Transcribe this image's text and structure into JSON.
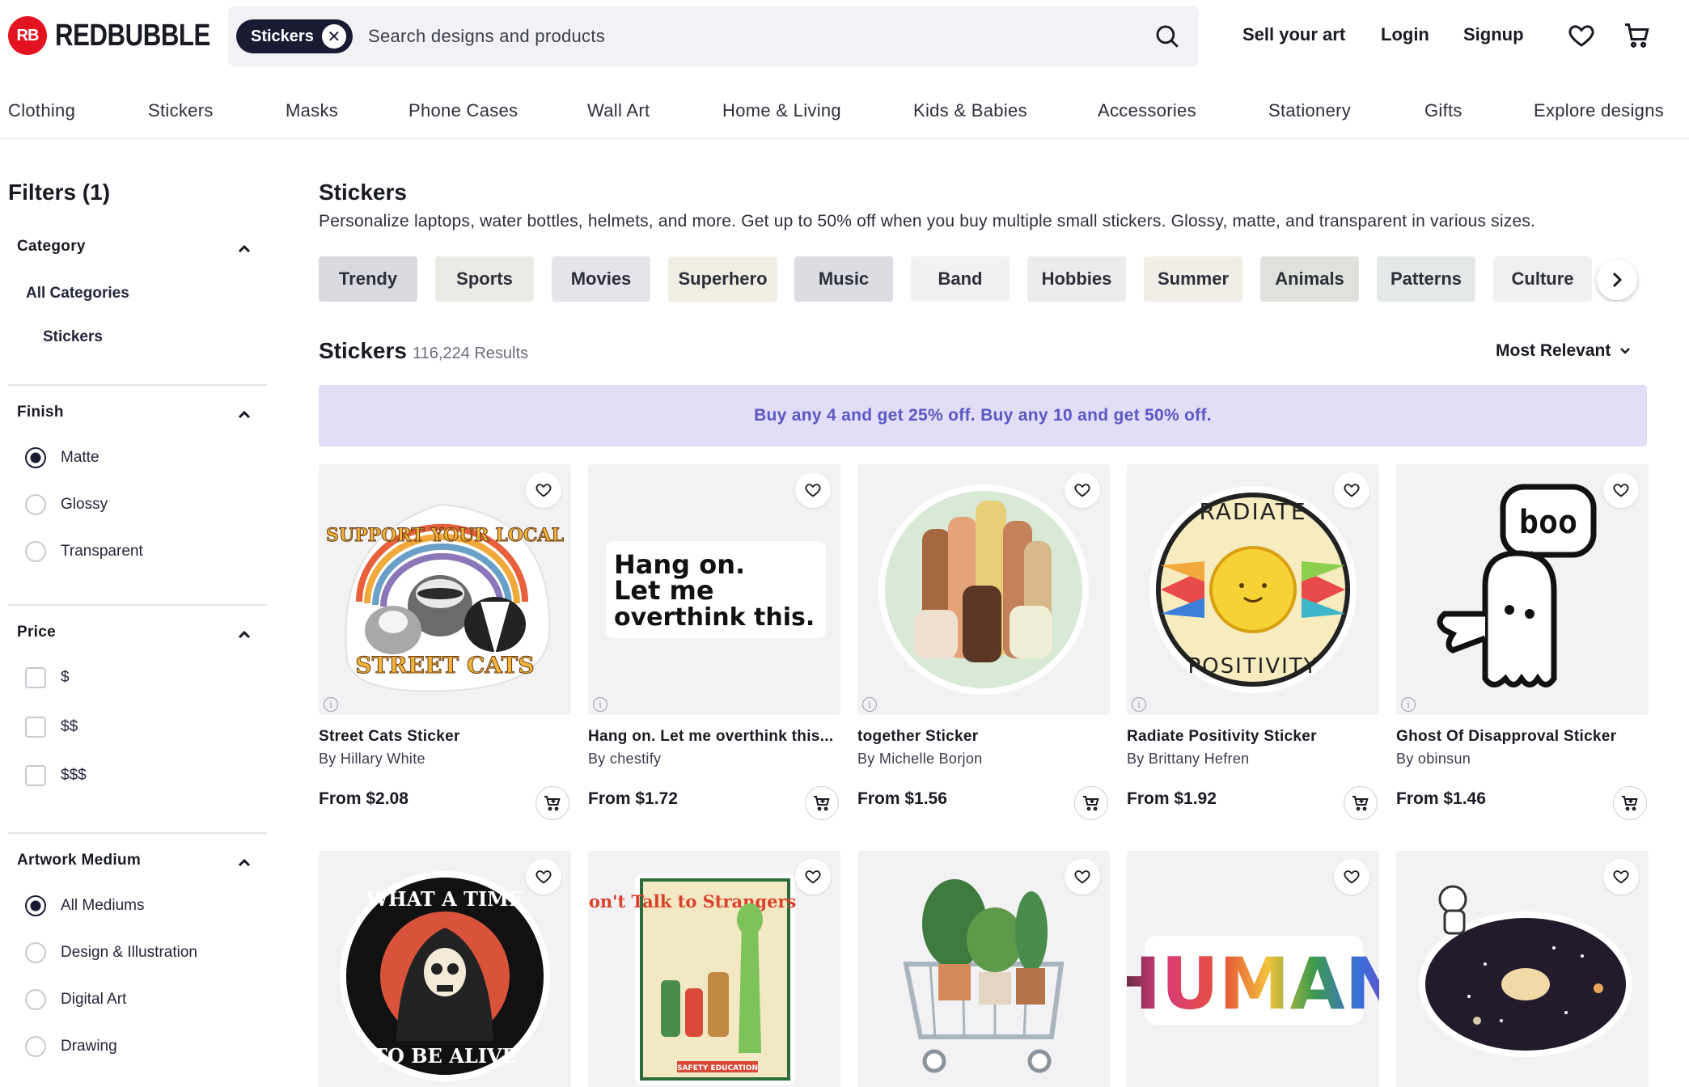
{
  "header": {
    "logo_mark": "RB",
    "logo_text": "REDBUBBLE",
    "search_chip": "Stickers",
    "search_placeholder": "Search designs and products",
    "links": {
      "sell": "Sell your art",
      "login": "Login",
      "signup": "Signup"
    }
  },
  "nav": [
    "Clothing",
    "Stickers",
    "Masks",
    "Phone Cases",
    "Wall Art",
    "Home & Living",
    "Kids & Babies",
    "Accessories",
    "Stationery",
    "Gifts",
    "Explore designs"
  ],
  "sidebar": {
    "title": "Filters (1)",
    "category": {
      "title": "Category",
      "all": "All Categories",
      "current": "Stickers"
    },
    "finish": {
      "title": "Finish",
      "options": [
        "Matte",
        "Glossy",
        "Transparent"
      ],
      "selected": "Matte"
    },
    "price": {
      "title": "Price",
      "options": [
        "$",
        "$$",
        "$$$"
      ]
    },
    "medium": {
      "title": "Artwork Medium",
      "options": [
        "All Mediums",
        "Design & Illustration",
        "Digital Art",
        "Drawing"
      ],
      "selected": "All Mediums"
    }
  },
  "main": {
    "title": "Stickers",
    "description": "Personalize laptops, water bottles, helmets, and more. Get up to 50% off when you buy multiple small stickers. Glossy, matte, and transparent in various sizes.",
    "pills": [
      {
        "label": "Trendy",
        "color": "#d9dadf"
      },
      {
        "label": "Sports",
        "color": "#ebebe6"
      },
      {
        "label": "Movies",
        "color": "#e4e4ea"
      },
      {
        "label": "Superhero",
        "color": "#f1efe4"
      },
      {
        "label": "Music",
        "color": "#dcdde3"
      },
      {
        "label": "Band",
        "color": "#f1f1f3"
      },
      {
        "label": "Hobbies",
        "color": "#ececef"
      },
      {
        "label": "Summer",
        "color": "#f0eee6"
      },
      {
        "label": "Animals",
        "color": "#dee1dc"
      },
      {
        "label": "Patterns",
        "color": "#e4e8e8"
      },
      {
        "label": "Culture",
        "color": "#f0f0f2"
      }
    ],
    "results_title": "Stickers",
    "results_count": "116,224 Results",
    "sort_label": "Most Relevant",
    "promo": "Buy any 4 and get 25% off.  Buy any 10 and get 50% off."
  },
  "products": [
    {
      "title": "Street Cats Sticker",
      "artist": "By Hillary White",
      "price": "From $2.08"
    },
    {
      "title": "Hang on. Let me overthink this...",
      "artist": "By chestify",
      "price": "From $1.72",
      "art_lines": [
        "Hang on.",
        "Let me",
        "overthink this."
      ]
    },
    {
      "title": "together Sticker",
      "artist": "By Michelle Borjon",
      "price": "From $1.56"
    },
    {
      "title": "Radiate Positivity Sticker",
      "artist": "By Brittany Hefren",
      "price": "From $1.92"
    },
    {
      "title": "Ghost Of Disapproval Sticker",
      "artist": "By obinsun",
      "price": "From $1.46",
      "art_text": "boo"
    },
    {
      "title": "",
      "artist": "",
      "price": ""
    },
    {
      "title": "",
      "artist": "",
      "price": ""
    },
    {
      "title": "",
      "artist": "",
      "price": ""
    },
    {
      "title": "",
      "artist": "",
      "price": "",
      "art_text": "HUMAN"
    },
    {
      "title": "",
      "artist": "",
      "price": ""
    }
  ],
  "art_lettering": {
    "street_cats_top": "SUPPORT YOUR LOCAL",
    "street_cats_bottom": "STREET CATS",
    "radiate_top": "RADIATE",
    "radiate_bottom": "POSITIVITY",
    "time_top": "WHAT A TIME",
    "time_bottom": "TO BE ALIVE",
    "strangers": "Don't Talk to Strangers",
    "safety": "SAFETY EDUCATION"
  },
  "colors": {
    "brand_red": "#e41321",
    "navy": "#191b33",
    "promo_bg": "#e2def7",
    "promo_text": "#5b57c4",
    "search_bg": "#f2f2f6"
  }
}
